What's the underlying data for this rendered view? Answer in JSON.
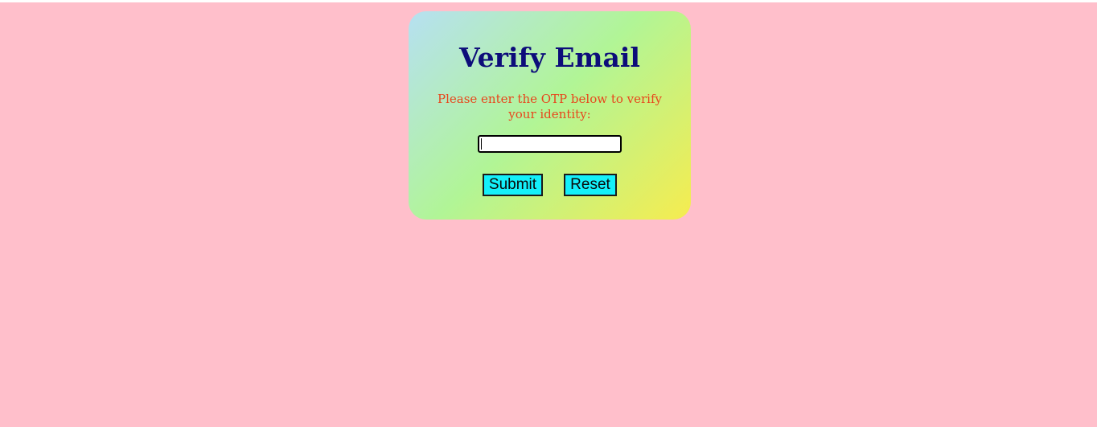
{
  "page": {
    "background_color": "#ffbfcb"
  },
  "card": {
    "title": "Verify Email",
    "instruction": "Please enter the OTP below to verify your identity:",
    "otp_input": {
      "value": "",
      "placeholder": ""
    },
    "submit_label": "Submit",
    "reset_label": "Reset",
    "colors": {
      "title": "#0d0d7a",
      "instruction": "#e8461c",
      "button_bg": "#14f0fa",
      "gradient_start": "#b6e0f2",
      "gradient_mid": "#b1f596",
      "gradient_end": "#f6ec4f"
    }
  }
}
